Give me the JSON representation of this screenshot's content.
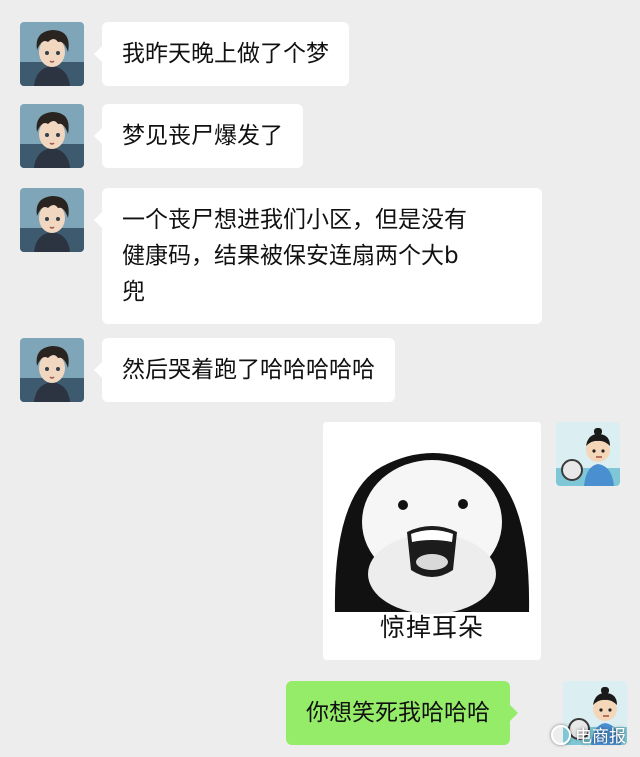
{
  "chat": {
    "messages": [
      {
        "side": "left",
        "text": "我昨天晚上做了个梦"
      },
      {
        "side": "left",
        "text": "梦见丧尸爆发了"
      },
      {
        "side": "left",
        "lines": [
          "一个丧尸想进我们小区，但是没有",
          "健康码，结果被保安连扇两个大b",
          "兜"
        ]
      },
      {
        "side": "left",
        "text": "然后哭着跑了哈哈哈哈哈"
      },
      {
        "side": "right",
        "type": "sticker",
        "caption": "惊掉耳朵"
      },
      {
        "side": "right",
        "text": "你想笑死我哈哈哈"
      }
    ]
  },
  "watermark": {
    "text": "电商报"
  },
  "colors": {
    "background": "#ededed",
    "bubble_left": "#ffffff",
    "bubble_right": "#95ec69"
  },
  "icons": {
    "left_avatar": "anime-boy-avatar-icon",
    "right_avatar": "cartoon-kid-avatar-icon"
  }
}
